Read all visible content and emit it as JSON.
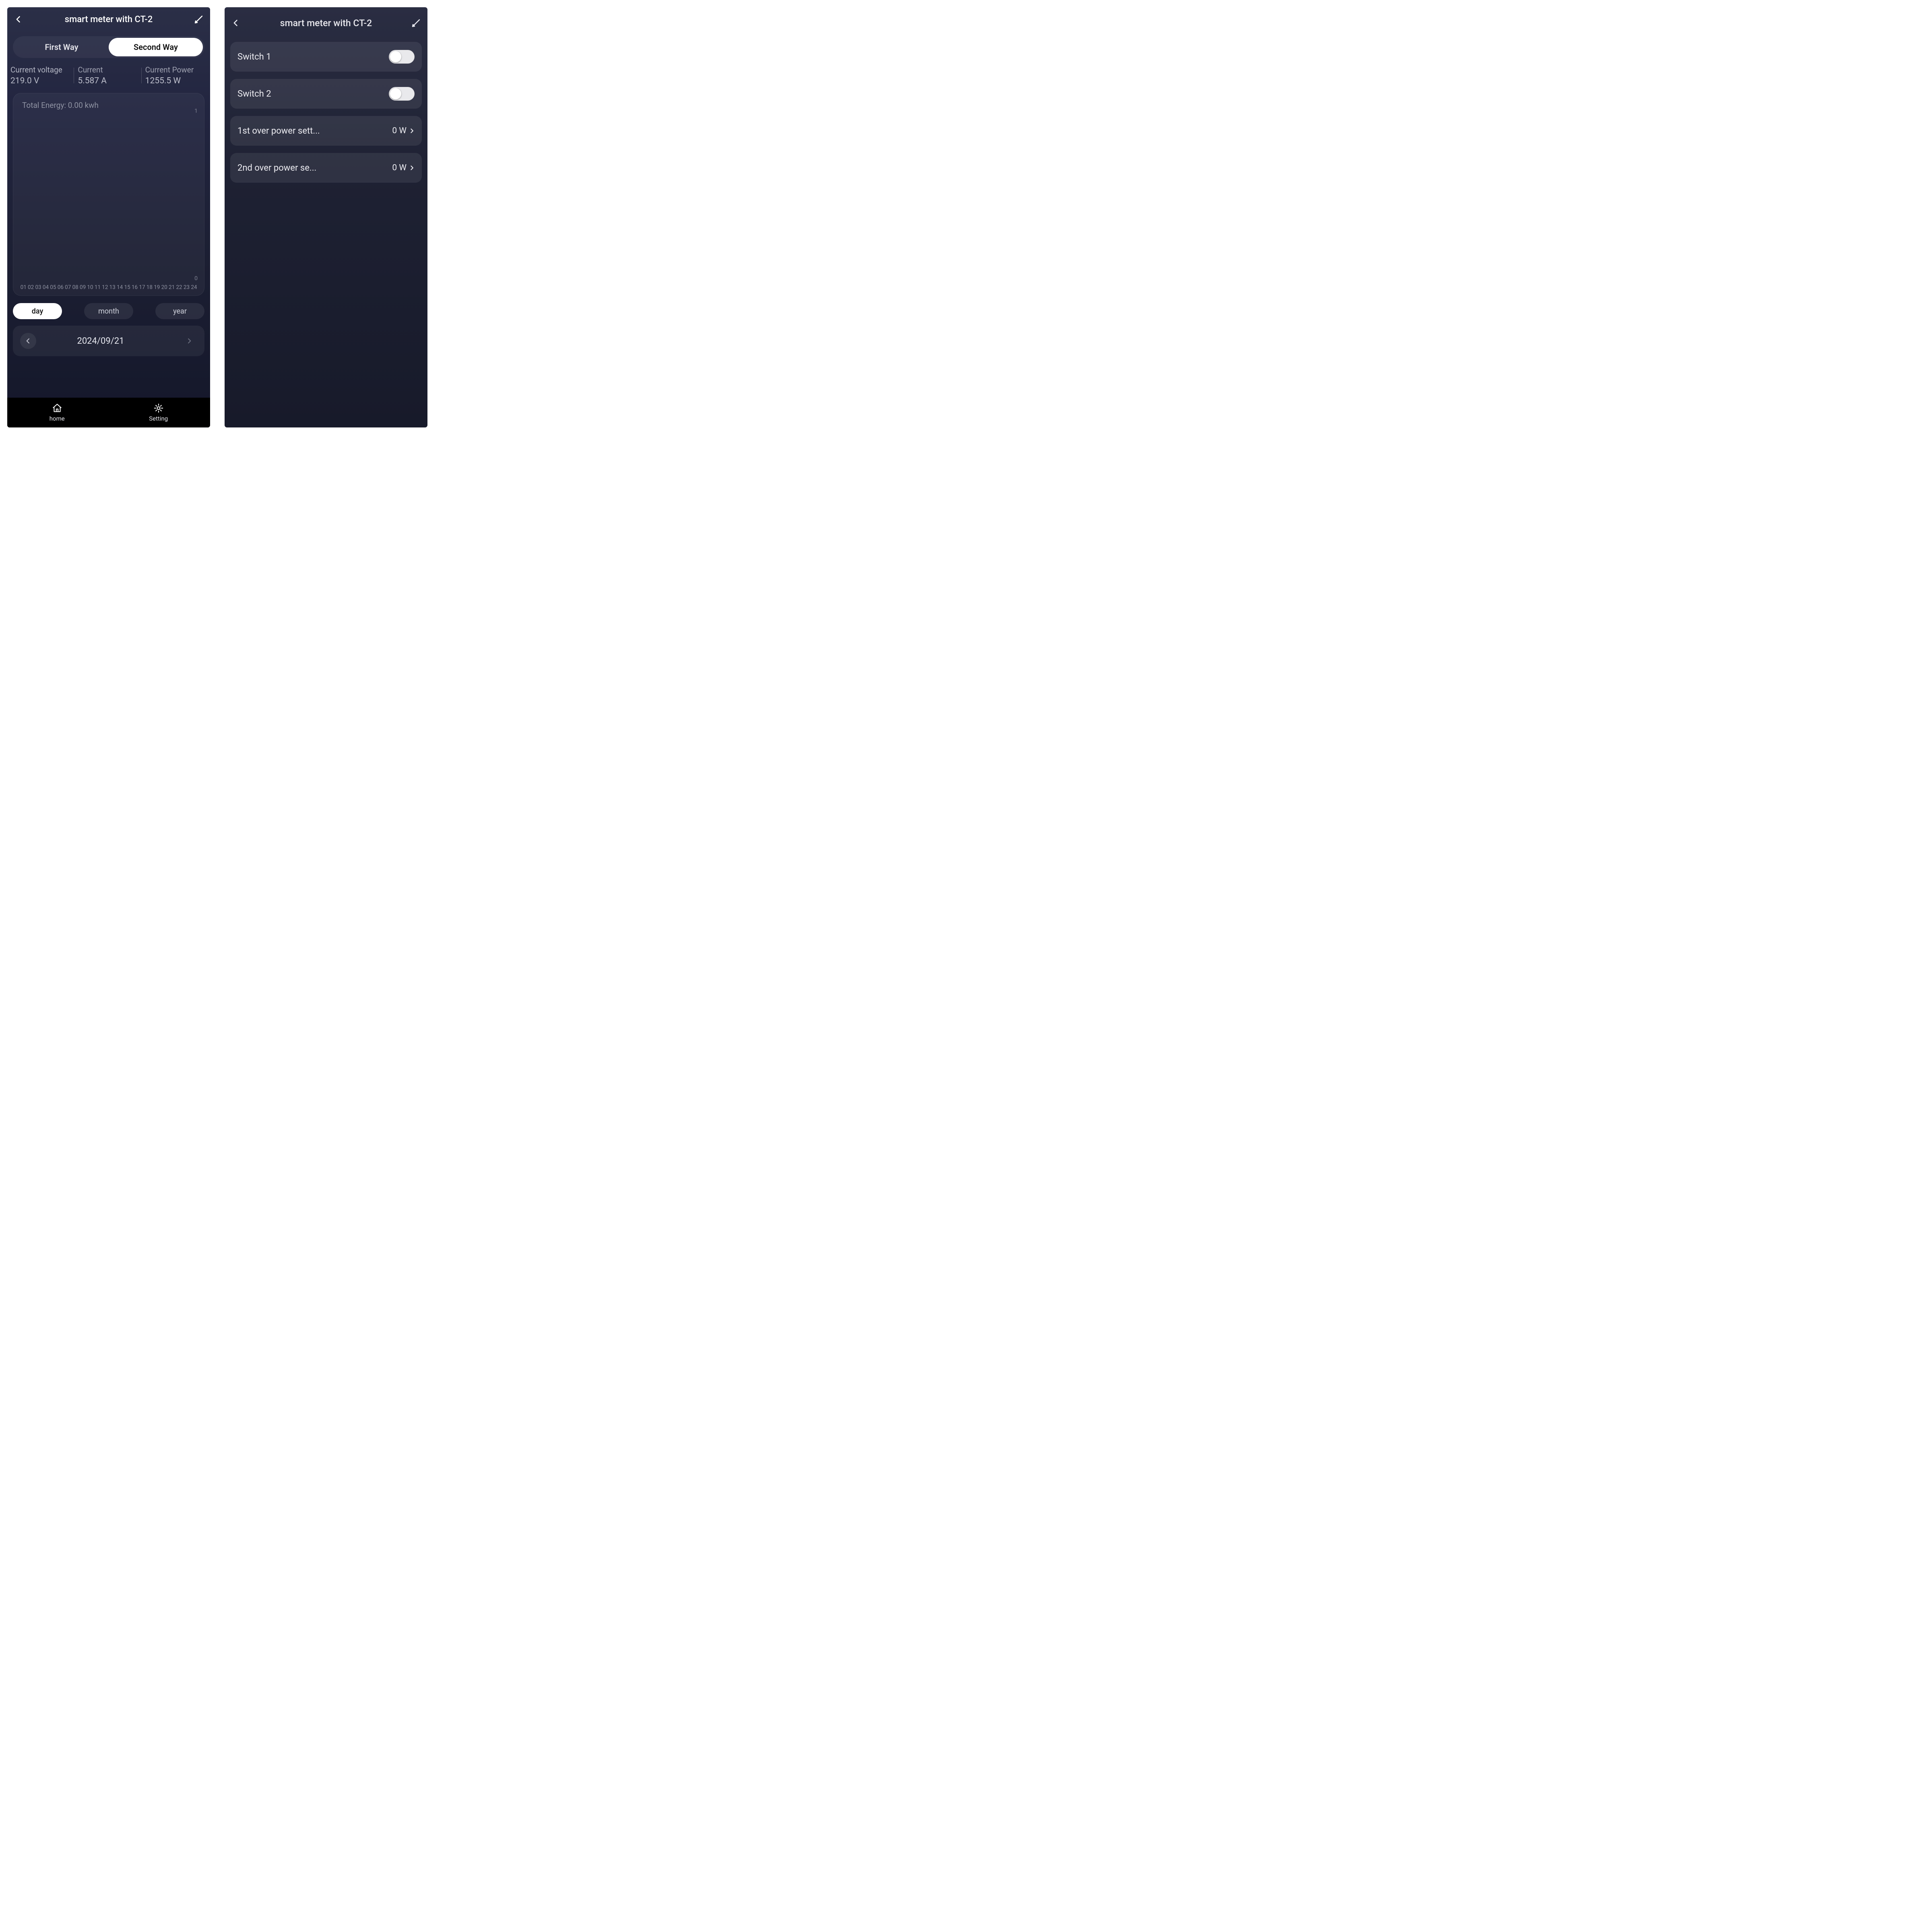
{
  "left": {
    "title": "smart meter with CT-2",
    "tabs": {
      "first": "First Way",
      "second": "Second Way"
    },
    "stats": {
      "voltage_label": "Current voltage",
      "voltage_value": "219.0 V",
      "current_label": "Current",
      "current_value": "5.587 A",
      "power_label": "Current Power",
      "power_value": "1255.5 W"
    },
    "chart": {
      "title": "Total Energy: 0.00 kwh",
      "ymax": "1",
      "ymin": "0",
      "xticks": [
        "01",
        "02",
        "03",
        "04",
        "05",
        "06",
        "07",
        "08",
        "09",
        "10",
        "11",
        "12",
        "13",
        "14",
        "15",
        "16",
        "17",
        "18",
        "19",
        "20",
        "21",
        "22",
        "23",
        "24"
      ]
    },
    "period": {
      "day": "day",
      "month": "month",
      "year": "year"
    },
    "date": "2024/09/21",
    "nav": {
      "home": "home",
      "setting": "Setting"
    }
  },
  "right": {
    "title": "smart meter with CT-2",
    "rows": {
      "switch1": "Switch 1",
      "switch2": "Switch 2",
      "over1": "1st over power sett...",
      "over1_val": "0 W",
      "over2": "2nd over power se...",
      "over2_val": "0 W"
    }
  },
  "chart_data": {
    "type": "bar",
    "title": "Total Energy: 0.00 kwh",
    "xlabel": "",
    "ylabel": "",
    "ylim": [
      0,
      1
    ],
    "categories": [
      "01",
      "02",
      "03",
      "04",
      "05",
      "06",
      "07",
      "08",
      "09",
      "10",
      "11",
      "12",
      "13",
      "14",
      "15",
      "16",
      "17",
      "18",
      "19",
      "20",
      "21",
      "22",
      "23",
      "24"
    ],
    "values": [
      0,
      0,
      0,
      0,
      0,
      0,
      0,
      0,
      0,
      0,
      0,
      0,
      0,
      0,
      0,
      0,
      0,
      0,
      0,
      0,
      0,
      0,
      0,
      0
    ]
  }
}
